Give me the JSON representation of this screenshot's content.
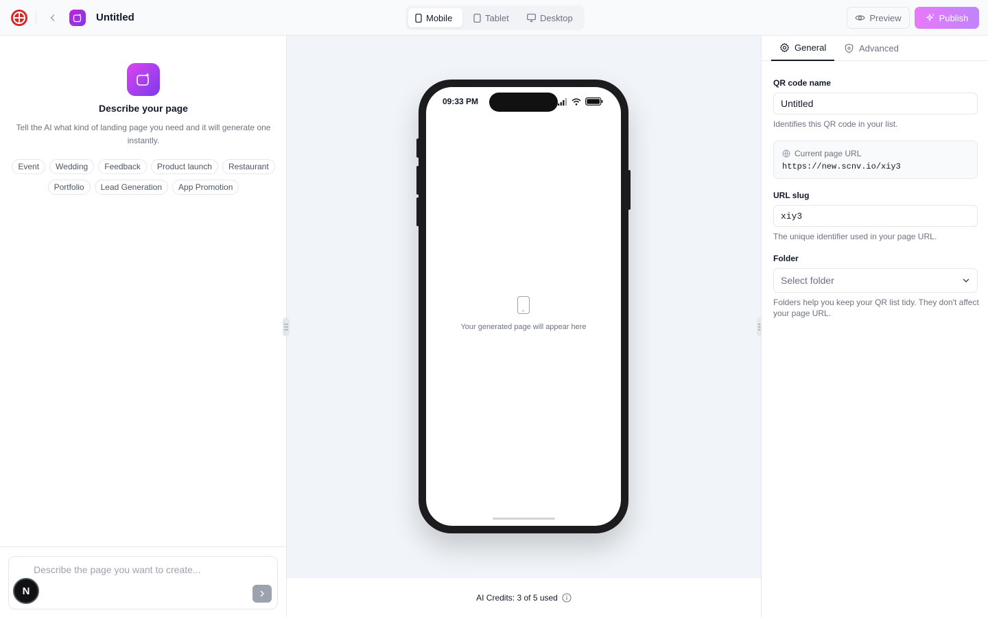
{
  "header": {
    "title": "Untitled",
    "devices": [
      {
        "label": "Mobile",
        "icon": "mobile-icon",
        "active": true
      },
      {
        "label": "Tablet",
        "icon": "tablet-icon",
        "active": false
      },
      {
        "label": "Desktop",
        "icon": "desktop-icon",
        "active": false
      }
    ],
    "preview_label": "Preview",
    "publish_label": "Publish"
  },
  "left": {
    "title": "Describe your page",
    "description": "Tell the AI what kind of landing page you need and it will generate one instantly.",
    "chips": [
      "Event",
      "Wedding",
      "Feedback",
      "Product launch",
      "Restaurant",
      "Portfolio",
      "Lead Generation",
      "App Promotion"
    ],
    "prompt_placeholder": "Describe the page you want to create...",
    "avatar_initial": "N"
  },
  "preview": {
    "status_time": "09:33 PM",
    "empty_text": "Your generated page will appear here",
    "credits": "AI Credits: 3 of 5 used"
  },
  "settings": {
    "tabs": [
      {
        "label": "General",
        "active": true
      },
      {
        "label": "Advanced",
        "active": false
      }
    ],
    "qr_name_label": "QR code name",
    "qr_name_value": "Untitled",
    "qr_name_help": "Identifies this QR code in your list.",
    "current_url_label": "Current page URL",
    "current_url_value": "https://new.scnv.io/xiy3",
    "slug_label": "URL slug",
    "slug_value": "xiy3",
    "slug_help": "The unique identifier used in your page URL.",
    "folder_label": "Folder",
    "folder_placeholder": "Select folder",
    "folder_help": "Folders help you keep your QR list tidy. They don't affect your page URL."
  },
  "colors": {
    "accent_start": "#d946ef",
    "accent_end": "#7c3aed",
    "border": "#e5e7eb",
    "muted_text": "#6b7280"
  }
}
